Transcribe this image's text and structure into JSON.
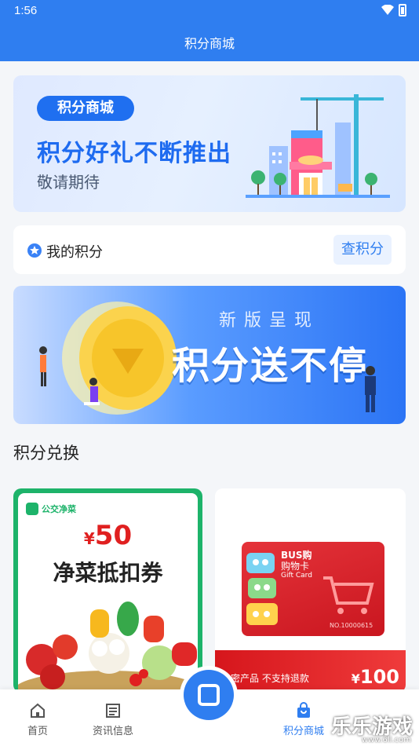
{
  "status": {
    "time": "1:56"
  },
  "header": {
    "title": "积分商城"
  },
  "banner_top": {
    "tag": "积分商城",
    "headline": "积分好礼不断推出",
    "subtitle": "敬请期待"
  },
  "my_points": {
    "label": "我的积分",
    "check_button": "查积分"
  },
  "banner_promo": {
    "kicker": "新版呈现",
    "headline": "积分送不停"
  },
  "section": {
    "exchange_title": "积分兑换"
  },
  "products": [
    {
      "brand": "公交净菜",
      "currency": "¥",
      "amount": "50",
      "title": "净菜抵扣券"
    },
    {
      "card_brand": "BUS购",
      "card_title": "购物卡",
      "card_subtitle": "Gift Card",
      "card_number": "NO.10000615",
      "notice": "密产品 不支持退款",
      "currency": "¥",
      "amount": "100"
    }
  ],
  "bottom_nav": {
    "items": [
      {
        "label": "首页",
        "icon": "home-icon"
      },
      {
        "label": "资讯信息",
        "icon": "news-icon"
      },
      {
        "label": "积分商城",
        "icon": "shop-bag-icon"
      }
    ],
    "center_icon": "bus-qr-icon"
  },
  "watermark": {
    "text": "乐乐游戏",
    "url": "www.6ll.com"
  },
  "colors": {
    "primary": "#2f7ef0",
    "accent_green": "#1db36a",
    "accent_red": "#e02020"
  }
}
